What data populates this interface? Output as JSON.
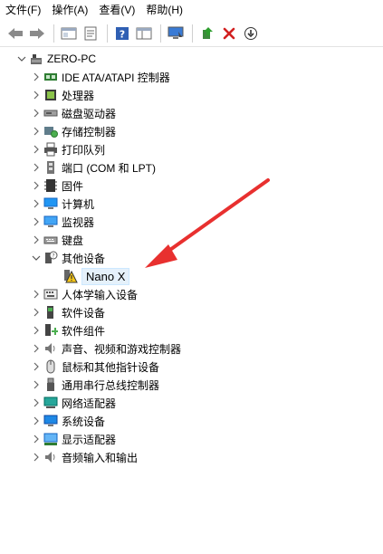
{
  "menu": [
    "文件(F)",
    "操作(A)",
    "查看(V)",
    "帮助(H)"
  ],
  "toolbar_icons": [
    "back-arrow-icon",
    "forward-arrow-icon",
    "show-hide-tree-icon",
    "properties-icon",
    "help-icon",
    "view-panel-icon",
    "monitor-scan-icon",
    "update-driver-icon",
    "uninstall-x-icon",
    "download-arrow-icon"
  ],
  "tree": {
    "root": "ZERO-PC",
    "categories": [
      {
        "label": "IDE ATA/ATAPI 控制器",
        "icon": "ide-controller-icon",
        "expanded": false
      },
      {
        "label": "处理器",
        "icon": "processor-icon",
        "expanded": false
      },
      {
        "label": "磁盘驱动器",
        "icon": "disk-drive-icon",
        "expanded": false
      },
      {
        "label": "存储控制器",
        "icon": "storage-controller-icon",
        "expanded": false
      },
      {
        "label": "打印队列",
        "icon": "printer-icon",
        "expanded": false
      },
      {
        "label": "端口 (COM 和 LPT)",
        "icon": "port-icon",
        "expanded": false
      },
      {
        "label": "固件",
        "icon": "firmware-icon",
        "expanded": false
      },
      {
        "label": "计算机",
        "icon": "computer-icon",
        "expanded": false
      },
      {
        "label": "监视器",
        "icon": "monitor-icon",
        "expanded": false
      },
      {
        "label": "键盘",
        "icon": "keyboard-icon",
        "expanded": false
      },
      {
        "label": "其他设备",
        "icon": "unknown-device-icon",
        "expanded": true,
        "children": [
          {
            "label": "Nano X",
            "icon": "warning-device-icon"
          }
        ]
      },
      {
        "label": "人体学输入设备",
        "icon": "hid-icon",
        "expanded": false
      },
      {
        "label": "软件设备",
        "icon": "software-device-icon",
        "expanded": false
      },
      {
        "label": "软件组件",
        "icon": "software-component-icon",
        "expanded": false
      },
      {
        "label": "声音、视频和游戏控制器",
        "icon": "sound-icon",
        "expanded": false
      },
      {
        "label": "鼠标和其他指针设备",
        "icon": "mouse-icon",
        "expanded": false
      },
      {
        "label": "通用串行总线控制器",
        "icon": "usb-icon",
        "expanded": false
      },
      {
        "label": "网络适配器",
        "icon": "network-adapter-icon",
        "expanded": false
      },
      {
        "label": "系统设备",
        "icon": "system-device-icon",
        "expanded": false
      },
      {
        "label": "显示适配器",
        "icon": "display-adapter-icon",
        "expanded": false
      },
      {
        "label": "音频输入和输出",
        "icon": "audio-io-icon",
        "expanded": false
      }
    ]
  },
  "colors": {
    "annotation_arrow": "#e8302f",
    "selection_bg": "#e5f1fb",
    "warning_yellow": "#f5c518"
  }
}
